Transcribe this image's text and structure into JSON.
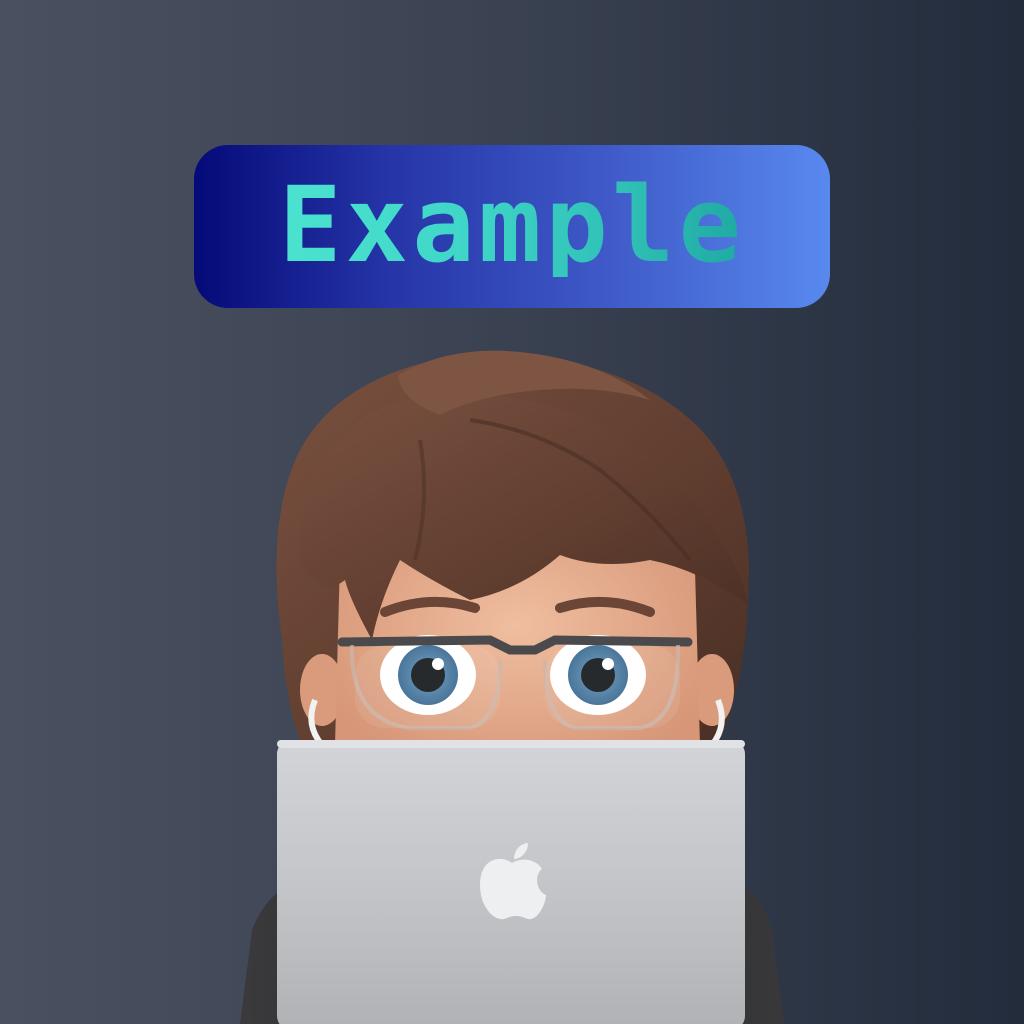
{
  "banner": {
    "text": "Example"
  },
  "avatar": {
    "icon": "memoji-avatar-icon",
    "laptop_logo_icon": "apple-logo-icon"
  },
  "colors": {
    "background_left": "#4a5060",
    "background_right": "#232c3c",
    "banner_left": "#050a78",
    "banner_right": "#5889ee",
    "banner_text": "#3fd6c8",
    "hair": "#6b4535",
    "skin": "#e0a98a",
    "laptop": "#c4c6ca"
  }
}
